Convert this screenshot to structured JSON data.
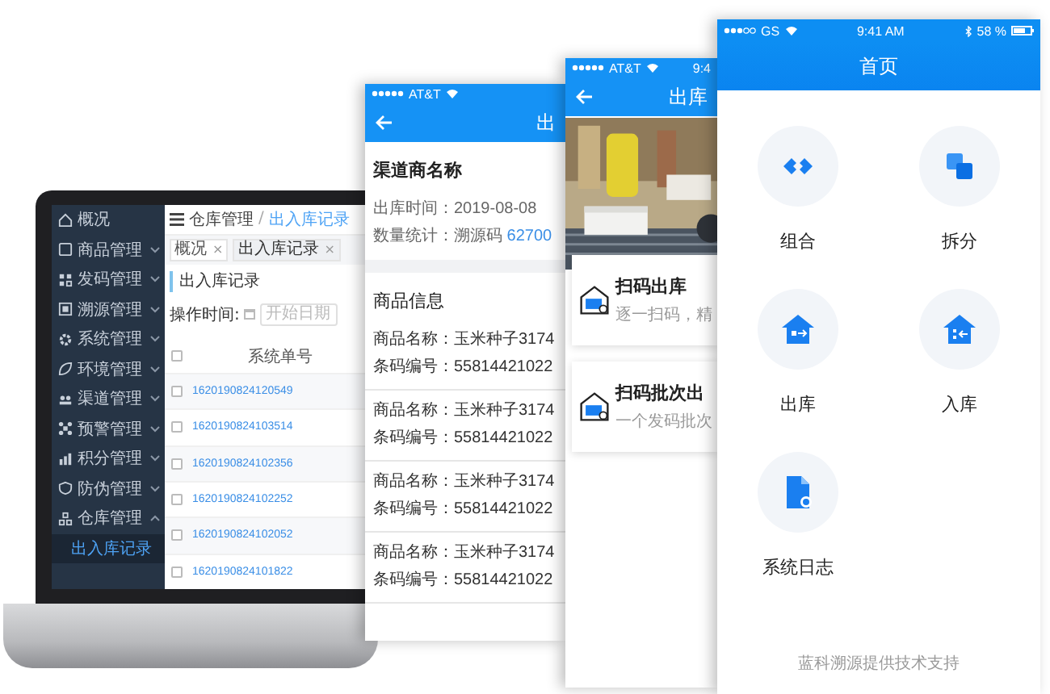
{
  "laptop": {
    "sidebar": {
      "items": [
        {
          "label": "概况",
          "kind": "link"
        },
        {
          "label": "商品管理",
          "kind": "group",
          "expanded": false
        },
        {
          "label": "发码管理",
          "kind": "group",
          "expanded": false
        },
        {
          "label": "溯源管理",
          "kind": "group",
          "expanded": false
        },
        {
          "label": "系统管理",
          "kind": "group",
          "expanded": false
        },
        {
          "label": "环境管理",
          "kind": "group",
          "expanded": false
        },
        {
          "label": "渠道管理",
          "kind": "group",
          "expanded": false
        },
        {
          "label": "预警管理",
          "kind": "group",
          "expanded": false
        },
        {
          "label": "积分管理",
          "kind": "group",
          "expanded": false
        },
        {
          "label": "防伪管理",
          "kind": "group",
          "expanded": false
        },
        {
          "label": "仓库管理",
          "kind": "group",
          "expanded": true,
          "children": [
            {
              "label": "出入库记录",
              "selected": true
            }
          ]
        }
      ]
    },
    "breadcrumb": {
      "items": [
        "仓库管理",
        "出入库记录"
      ],
      "separator": "/"
    },
    "tabs": [
      {
        "label": "概况",
        "close": "×",
        "selected": false
      },
      {
        "label": "出入库记录",
        "close": "×",
        "selected": true
      }
    ],
    "page_title": "出入库记录",
    "filter": {
      "label": "操作时间:",
      "placeholder": "开始日期"
    },
    "table": {
      "header_checked": false,
      "columns": [
        "系统单号"
      ],
      "rows": [
        {
          "checked": false,
          "order_no": "1620190824120549"
        },
        {
          "checked": false,
          "order_no": "1620190824103514"
        },
        {
          "checked": false,
          "order_no": "1620190824102356"
        },
        {
          "checked": false,
          "order_no": "1620190824102252"
        },
        {
          "checked": false,
          "order_no": "1620190824102052"
        },
        {
          "checked": false,
          "order_no": "1620190824101822"
        }
      ]
    }
  },
  "phones": [
    {
      "kind": "detail",
      "status": {
        "carrier": "AT&T"
      },
      "title": "出",
      "summary": {
        "name": "渠道商名称",
        "lines": [
          {
            "text": "出库时间：2019-08-08"
          },
          {
            "text": "数量统计：溯源码",
            "value": "62700"
          }
        ]
      },
      "section": "商品信息",
      "products": [
        {
          "name": "商品名称：玉米种子3174",
          "code": "条码编号：55814421022"
        },
        {
          "name": "商品名称：玉米种子3174",
          "code": "条码编号：55814421022"
        },
        {
          "name": "商品名称：玉米种子3174",
          "code": "条码编号：55814421022"
        },
        {
          "name": "商品名称：玉米种子3174",
          "code": "条码编号：55814421022"
        }
      ]
    },
    {
      "kind": "menu",
      "status": {
        "carrier": "AT&T",
        "time": "9:4"
      },
      "title": "出库",
      "hero": {
        "kind": "picture"
      },
      "cards": [
        {
          "title": "扫码出库",
          "desc": "逐一扫码，精"
        },
        {
          "title": "扫码批次出",
          "desc": "一个发码批次"
        }
      ]
    },
    {
      "kind": "home",
      "status": {
        "carrier": "GS",
        "time": "9:41 AM",
        "battery": "58 %"
      },
      "title": "首页",
      "tiles": [
        {
          "label": "组合",
          "kind": "combine"
        },
        {
          "label": "拆分",
          "kind": "split"
        },
        {
          "label": "出库",
          "kind": "outbound"
        },
        {
          "label": "入库",
          "kind": "inbound"
        },
        {
          "label": "系统日志",
          "kind": "log"
        }
      ],
      "footer": "蓝科溯源提供技术支持"
    }
  ]
}
